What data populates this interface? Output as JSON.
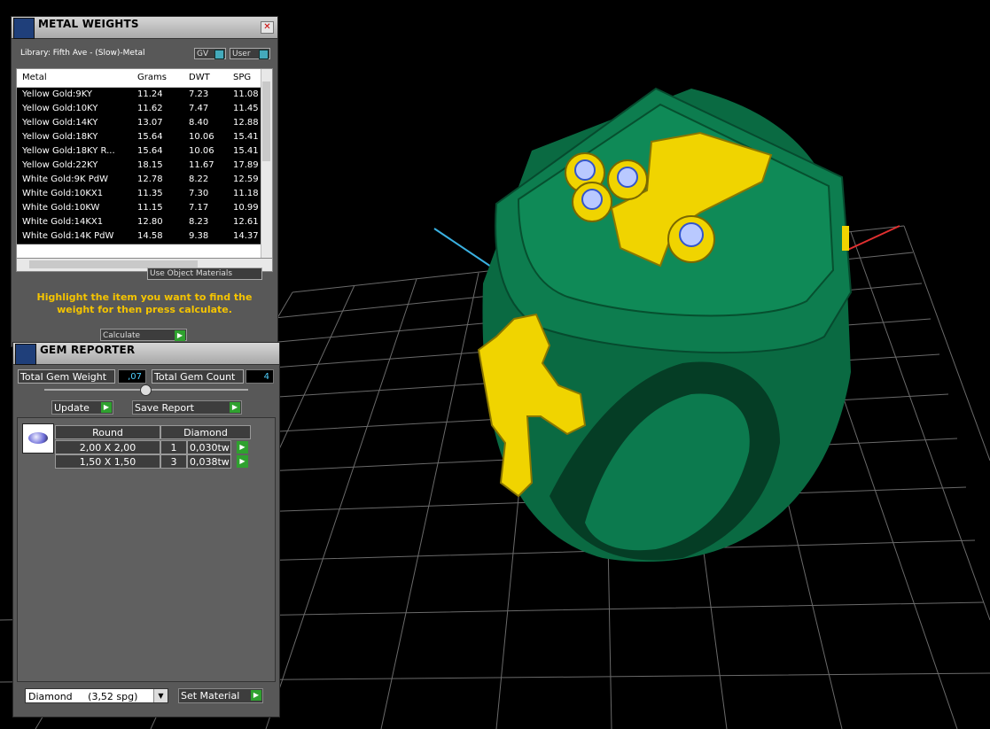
{
  "metal_panel": {
    "title": "METAL WEIGHTS",
    "library": "Library: Fifth Ave - (Slow)-Metal",
    "gv_label": "GV",
    "user_label": "User",
    "columns": [
      "Metal",
      "Grams",
      "DWT",
      "SPG"
    ],
    "rows": [
      [
        "Yellow Gold:9KY",
        "11.24",
        "7.23",
        "11.08"
      ],
      [
        "Yellow Gold:10KY",
        "11.62",
        "7.47",
        "11.45"
      ],
      [
        "Yellow Gold:14KY",
        "13.07",
        "8.40",
        "12.88"
      ],
      [
        "Yellow Gold:18KY",
        "15.64",
        "10.06",
        "15.41"
      ],
      [
        "Yellow Gold:18KY R...",
        "15.64",
        "10.06",
        "15.41"
      ],
      [
        "Yellow Gold:22KY",
        "18.15",
        "11.67",
        "17.89"
      ],
      [
        "White Gold:9K PdW",
        "12.78",
        "8.22",
        "12.59"
      ],
      [
        "White Gold:10KX1",
        "11.35",
        "7.30",
        "11.18"
      ],
      [
        "White Gold:10KW",
        "11.15",
        "7.17",
        "10.99"
      ],
      [
        "White Gold:14KX1",
        "12.80",
        "8.23",
        "12.61"
      ],
      [
        "White Gold:14K PdW",
        "14.58",
        "9.38",
        "14.37"
      ]
    ],
    "use_object_materials": "Use Object Materials",
    "hint": "Highlight the item you want to find the weight for then press calculate.",
    "calculate_label": "Calculate"
  },
  "gem_panel": {
    "title": "GEM REPORTER",
    "total_weight_label": "Total Gem Weight",
    "total_weight_value": ",07",
    "total_count_label": "Total Gem Count",
    "total_count_value": "4",
    "update_label": "Update",
    "save_report_label": "Save Report",
    "shape": "Round",
    "material": "Diamond",
    "gems": [
      {
        "size": "2,00 X 2,00",
        "count": "1",
        "weight": "0,030tw"
      },
      {
        "size": "1,50 X 1,50",
        "count": "3",
        "weight": "0,038tw"
      }
    ],
    "material_select": "Diamond     (3,52 spg)",
    "set_material_label": "Set Material"
  },
  "colors": {
    "ring": "#0c7a4e",
    "gold": "#f0d400",
    "hint": "#f5c400",
    "accent_go": "#2fa12f"
  }
}
